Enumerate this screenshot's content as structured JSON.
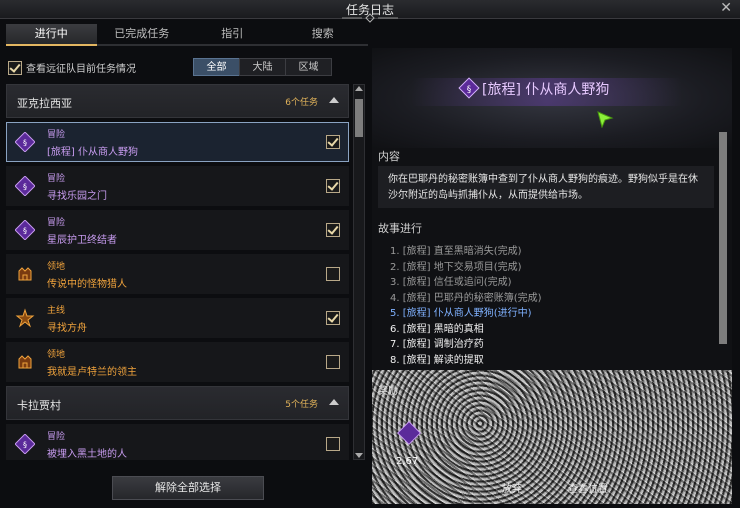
{
  "window": {
    "title": "任务日志"
  },
  "tabs": [
    {
      "label": "进行中"
    },
    {
      "label": "已完成任务"
    },
    {
      "label": "指引"
    },
    {
      "label": "搜索"
    }
  ],
  "filter": {
    "expedition_label": "查看远征队目前任务情况",
    "expedition_checked": true,
    "segments": [
      {
        "label": "全部"
      },
      {
        "label": "大陆"
      },
      {
        "label": "区域"
      }
    ],
    "selected_segment": "全部"
  },
  "groups": [
    {
      "name": "亚克拉西亚",
      "count": "6个任务",
      "quests": [
        {
          "type": "冒险",
          "name": "[旅程] 仆从商人野狗",
          "icon": "journey-icon",
          "checked": true,
          "selected": true,
          "color": "#c89cf0"
        },
        {
          "type": "冒险",
          "name": "寻找乐园之门",
          "icon": "journey-icon",
          "checked": true,
          "selected": false,
          "color": "#c89cf0"
        },
        {
          "type": "冒险",
          "name": "星辰护卫终结者",
          "icon": "journey-icon",
          "checked": true,
          "selected": false,
          "color": "#c89cf0"
        },
        {
          "type": "领地",
          "name": "传说中的怪物猎人",
          "icon": "territory-icon",
          "checked": false,
          "selected": false,
          "color": "#f0a33c"
        },
        {
          "type": "主线",
          "name": "寻找方舟",
          "icon": "mainline-icon",
          "checked": true,
          "selected": false,
          "color": "#f0a33c"
        },
        {
          "type": "领地",
          "name": "我就是卢特兰的领主",
          "icon": "territory-icon",
          "checked": false,
          "selected": false,
          "color": "#f0a33c"
        }
      ]
    },
    {
      "name": "卡拉贾村",
      "count": "5个任务",
      "quests": [
        {
          "type": "冒险",
          "name": "被埋入黑土地的人",
          "icon": "journey-icon",
          "checked": false,
          "selected": false,
          "color": "#c89cf0"
        }
      ]
    }
  ],
  "clear_button": "解除全部选择",
  "detail": {
    "title": "[旅程] 仆从商人野狗",
    "content_label": "内容",
    "content": "你在巴耶丹的秘密账簿中查到了仆从商人野狗的痕迹。野狗似乎是在休沙尔附近的岛屿抓捕仆从，从而提供给市场。",
    "story_label": "故事进行",
    "story": [
      {
        "text": "1. [旅程] 直至黑暗消失(完成)",
        "state": "done"
      },
      {
        "text": "2. [旅程] 地下交易项目(完成)",
        "state": "done"
      },
      {
        "text": "3. [旅程] 信任或追问(完成)",
        "state": "done"
      },
      {
        "text": "4. [旅程] 巴耶丹的秘密账簿(完成)",
        "state": "done"
      },
      {
        "text": "5. [旅程] 仆从商人野狗(进行中)",
        "state": "cur"
      },
      {
        "text": "6. [旅程] 黑暗的真相",
        "state": "todo"
      },
      {
        "text": "7. [旅程] 调制治疗药",
        "state": "todo"
      },
      {
        "text": "8. [旅程] 解读的提取",
        "state": "todo"
      }
    ],
    "reward_label": "奖励",
    "reward_count": "2,67",
    "reward_btn_1": "放弃",
    "reward_btn_2": "查看位置"
  },
  "colors": {
    "accent": "#e3b661",
    "journey": "#8e4dd6",
    "selected_border": "#8aa3c2"
  }
}
